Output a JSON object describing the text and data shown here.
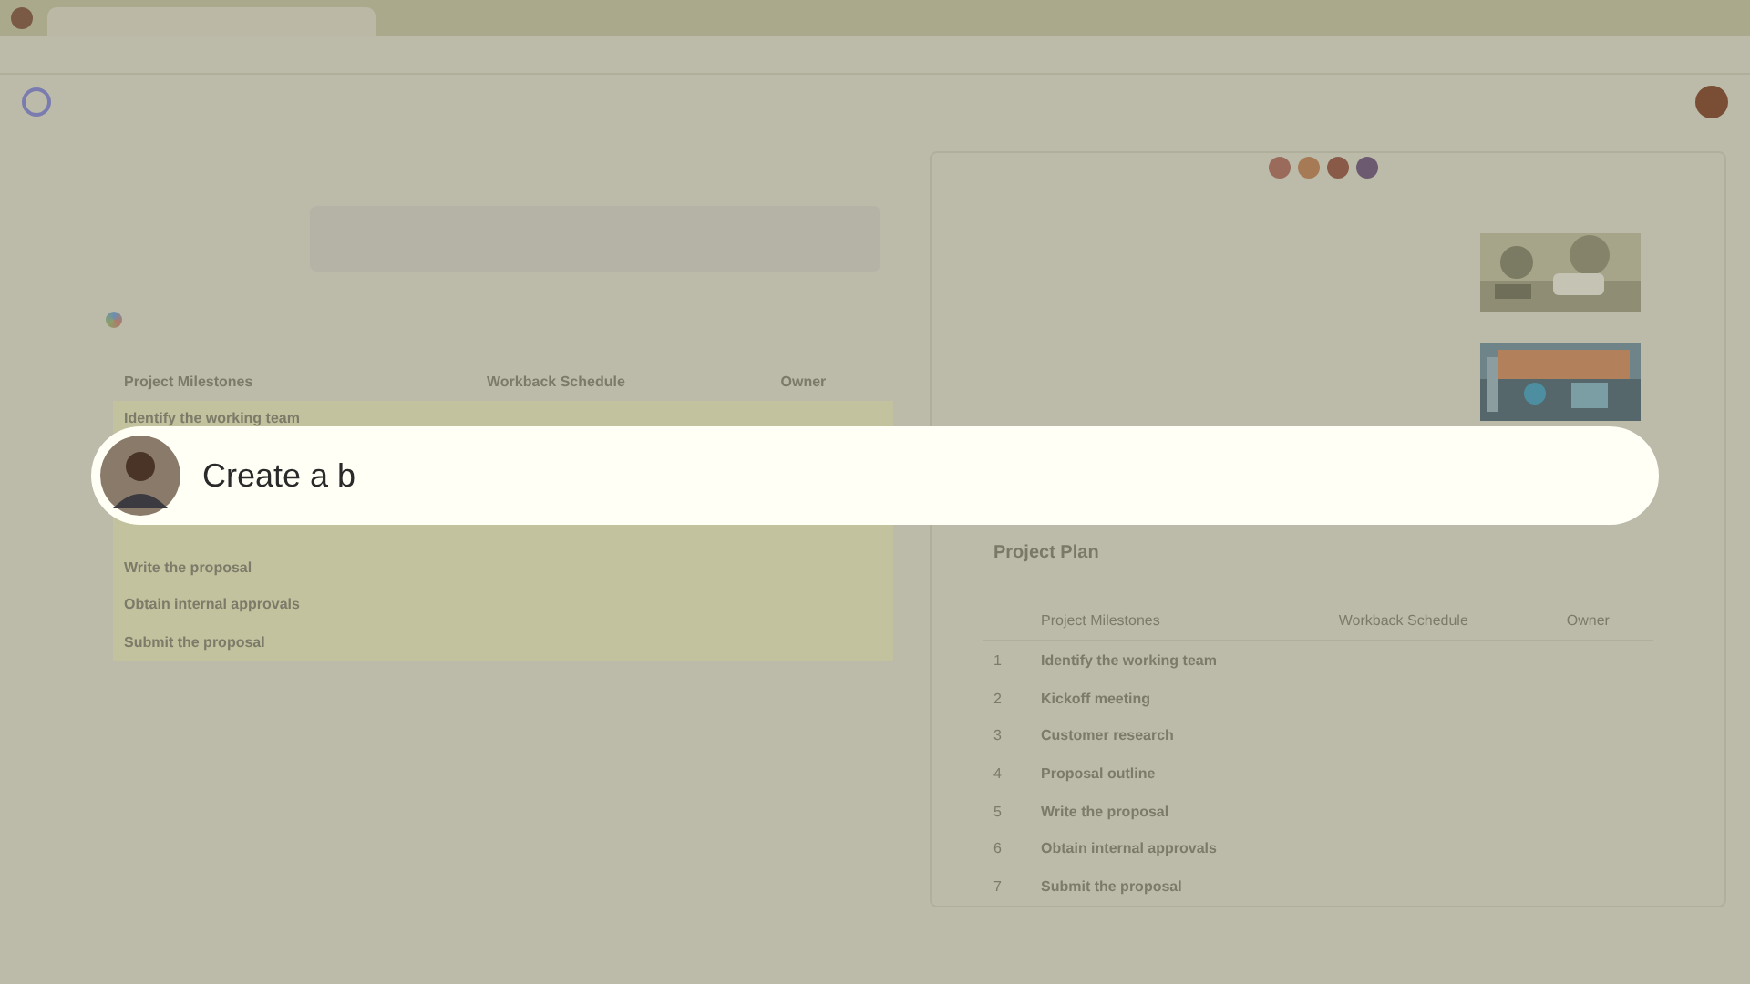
{
  "prompt": {
    "value": "Create a b"
  },
  "chat_table": {
    "columns": [
      "Project Milestones",
      "Workback Schedule",
      "Owner"
    ],
    "rows": [
      {
        "milestone": "Identify the working team"
      },
      {
        "milestone": "Write the proposal"
      },
      {
        "milestone": "Obtain internal approvals"
      },
      {
        "milestone": "Submit the proposal"
      }
    ]
  },
  "loop_page": {
    "title": "Project Plan",
    "columns": [
      "Project Milestones",
      "Workback Schedule",
      "Owner"
    ],
    "rows": [
      {
        "number": "1",
        "milestone": "Identify the working team"
      },
      {
        "number": "2",
        "milestone": "Kickoff meeting"
      },
      {
        "number": "3",
        "milestone": "Customer research"
      },
      {
        "number": "4",
        "milestone": "Proposal outline"
      },
      {
        "number": "5",
        "milestone": "Write the proposal"
      },
      {
        "number": "6",
        "milestone": "Obtain internal approvals"
      },
      {
        "number": "7",
        "milestone": "Submit the proposal"
      }
    ]
  }
}
